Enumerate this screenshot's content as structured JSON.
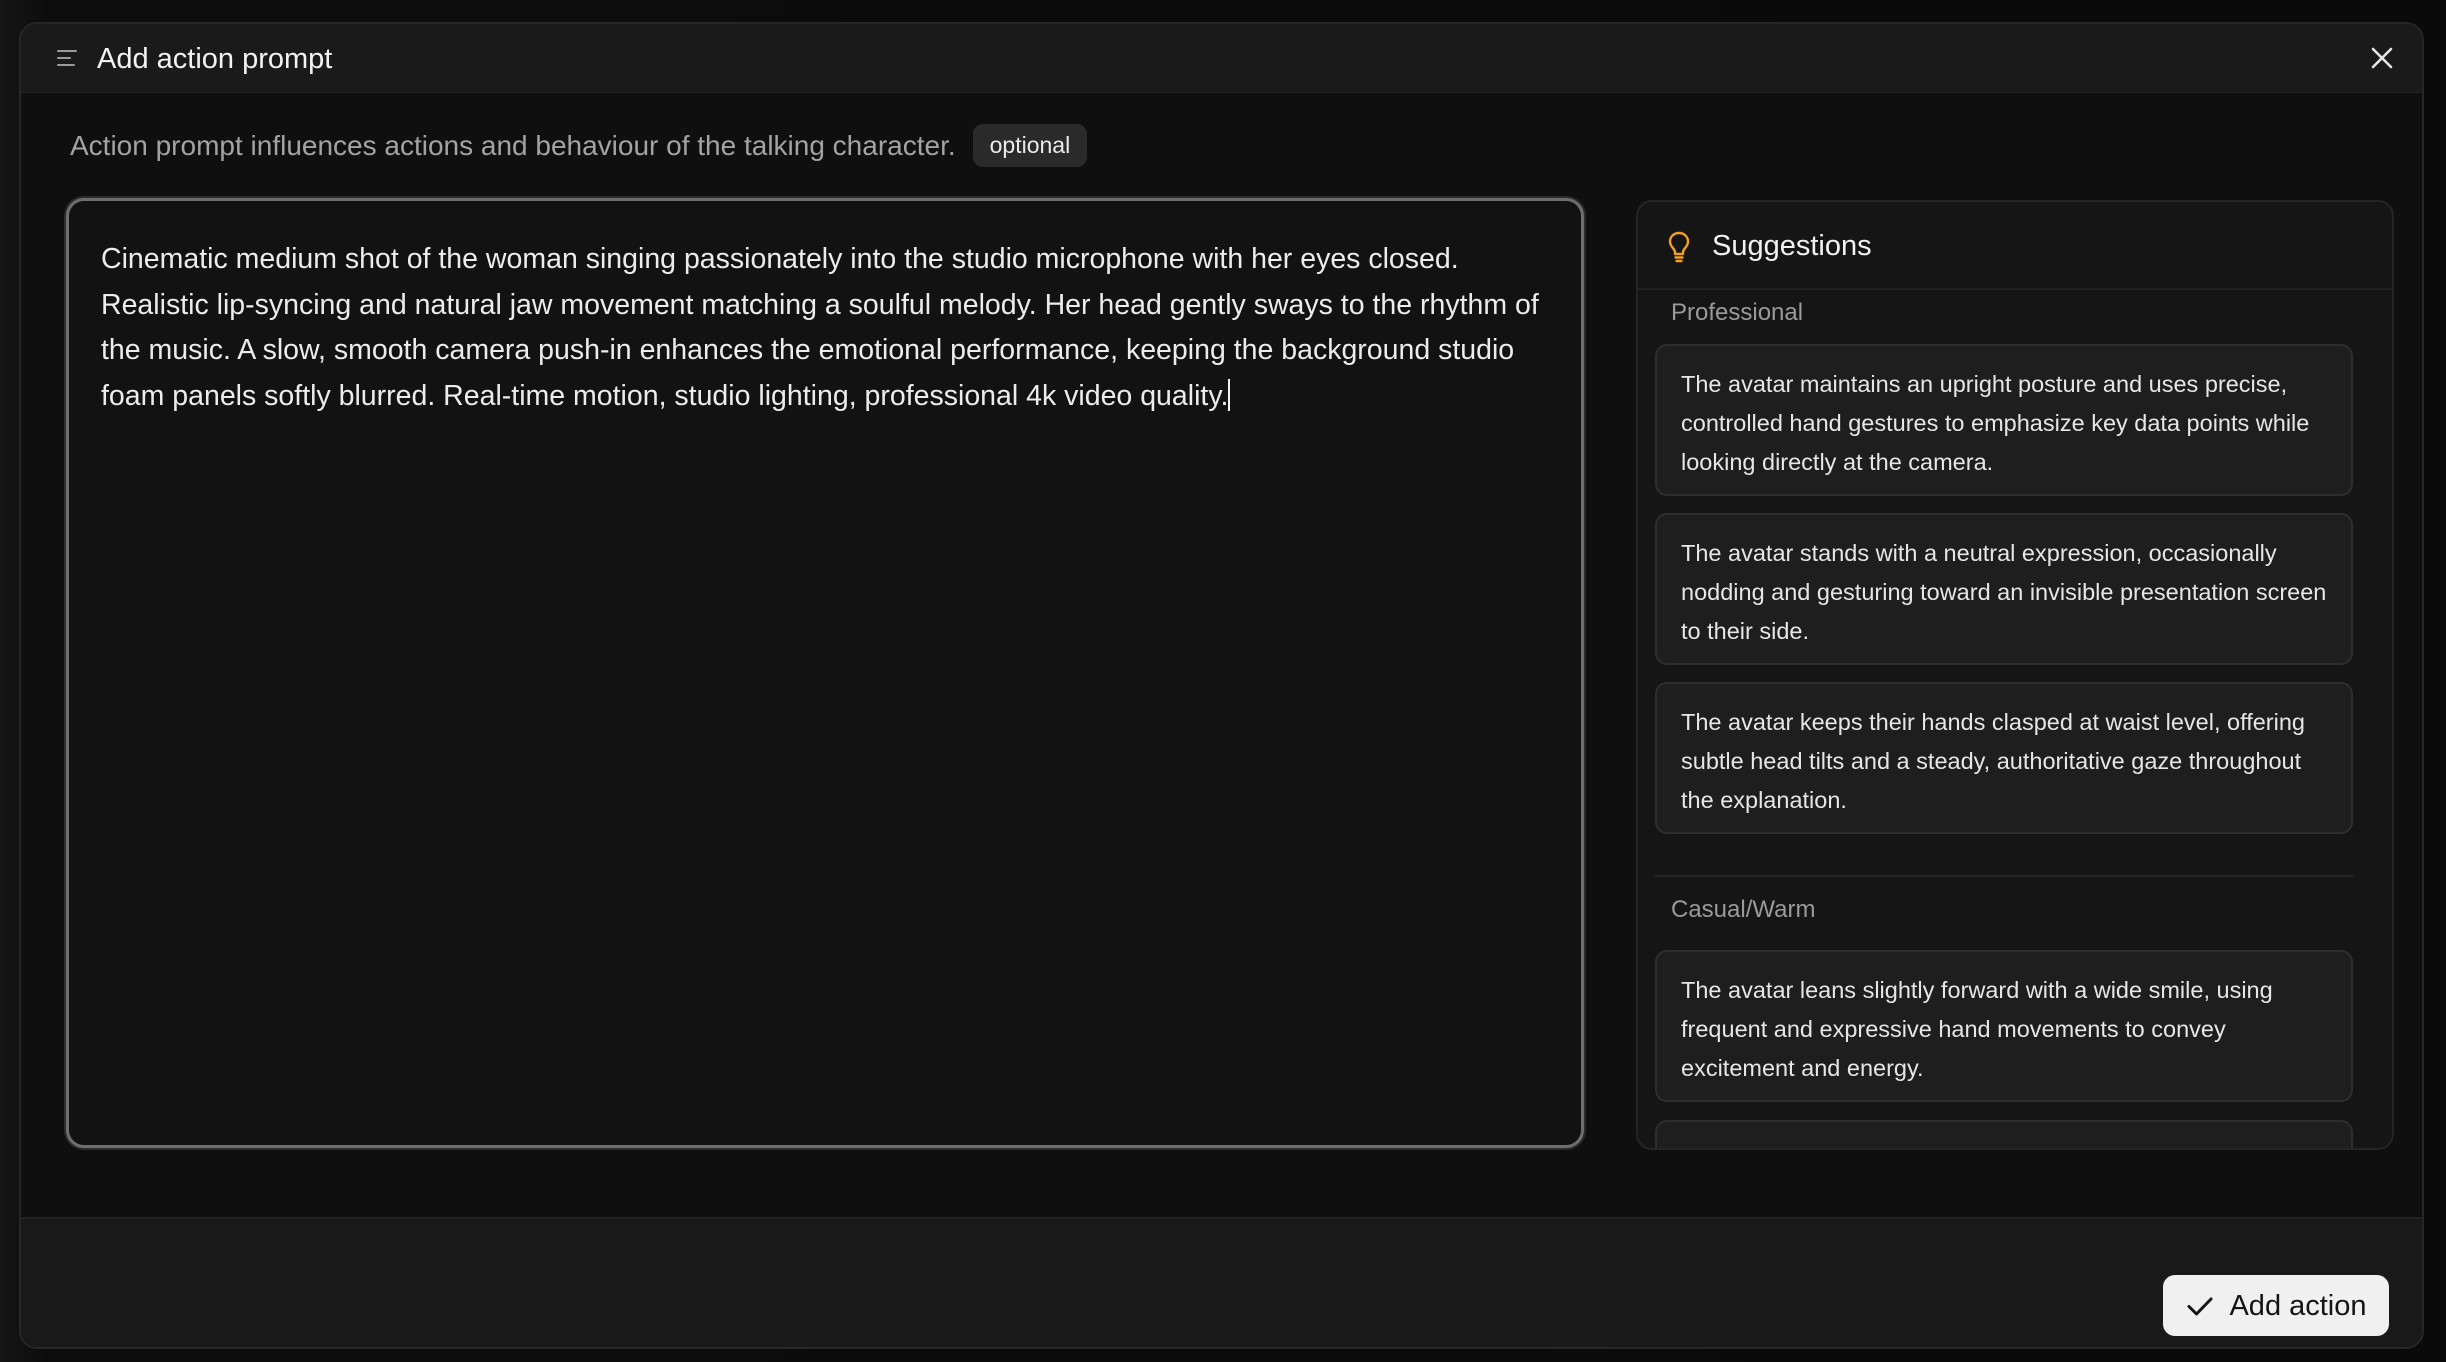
{
  "modal": {
    "title": "Add action prompt",
    "subtitle": "Action prompt influences actions and behaviour of the talking character.",
    "badge": "optional"
  },
  "prompt": {
    "value": "Cinematic medium shot of the woman singing passionately into the studio microphone with her eyes closed. Realistic lip-syncing and natural jaw movement matching a soulful melody. Her head gently sways to the rhythm of the music. A slow, smooth camera push-in enhances the emotional performance, keeping the background studio foam panels softly blurred. Real-time motion, studio lighting, professional 4k video quality."
  },
  "suggestions": {
    "title": "Suggestions",
    "groups": [
      {
        "label": "Professional",
        "items": [
          "The avatar maintains an upright posture and uses precise, controlled hand gestures to emphasize key data points while looking directly at the camera.",
          "The avatar stands with a neutral expression, occasionally nodding and gesturing toward an invisible presentation screen to their side.",
          "The avatar keeps their hands clasped at waist level, offering subtle head tilts and a steady, authoritative gaze throughout the explanation."
        ]
      },
      {
        "label": "Casual/Warm",
        "items": [
          "The avatar leans slightly forward with a wide smile, using frequent and expressive hand movements to convey excitement and energy."
        ]
      }
    ]
  },
  "footer": {
    "add_label": "Add action"
  },
  "icons": {
    "menu": "menu-icon",
    "close": "close-icon",
    "bulb": "lightbulb-icon",
    "check": "check-icon"
  },
  "colors": {
    "accent_bulb": "#f0a020",
    "primary_button": "#f0f0f0"
  }
}
